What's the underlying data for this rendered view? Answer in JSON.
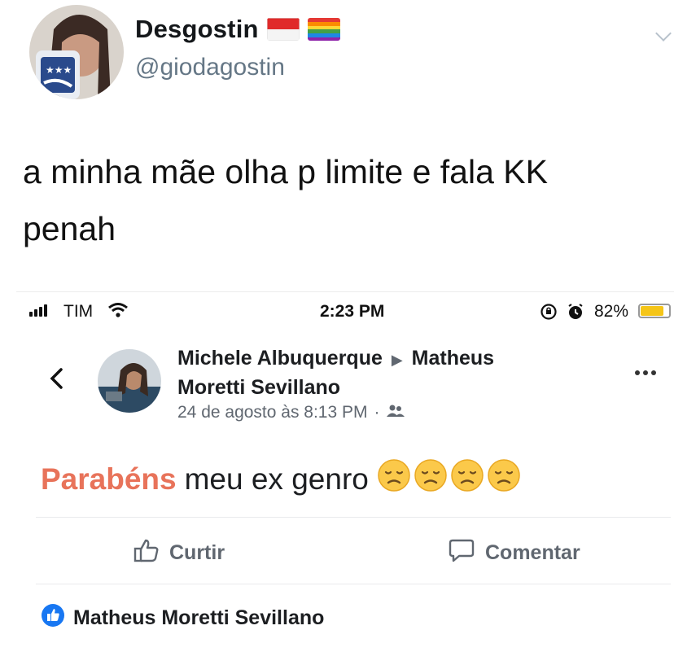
{
  "tweet": {
    "display_name": "Desgostin",
    "handle": "@giodagostin",
    "text_line1": "a minha mãe olha p limite e fala KK",
    "text_line2": "penah",
    "icons": [
      "indonesia-flag-icon",
      "rainbow-flag-icon",
      "chevron-down-icon"
    ]
  },
  "embedded_screenshot": {
    "status_bar": {
      "carrier": "TIM",
      "time": "2:23 PM",
      "battery_percent": "82%",
      "battery_level": 0.82,
      "battery_color": "#f5c518"
    },
    "post": {
      "author": "Michele Albuquerque",
      "target": "Matheus Moretti Sevillano",
      "target_line1": "Matheus",
      "target_line2": "Moretti Sevillano",
      "timestamp": "24 de agosto às 8:13 PM",
      "separator": "·",
      "privacy_icon": "friends-icon",
      "text_highlight": "Parabéns",
      "text_rest": "meu ex genro",
      "emoji_count": 4,
      "emoji_name": "disappointed-face-icon",
      "highlight_color": "#e8735a"
    },
    "actions": {
      "like_label": "Curtir",
      "comment_label": "Comentar"
    },
    "reactions": {
      "liker_name": "Matheus Moretti Sevillano",
      "like_color": "#1877f2"
    }
  }
}
